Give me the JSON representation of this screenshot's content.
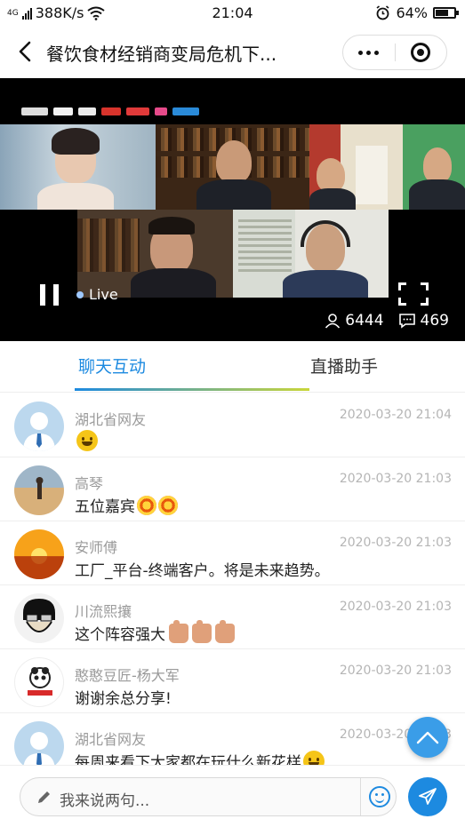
{
  "status_bar": {
    "signal": "4G",
    "speed": "388K/s",
    "time": "21:04",
    "battery": "64%"
  },
  "header": {
    "title": "餐饮食材经销商变局危机下..."
  },
  "video": {
    "live_label": "Live",
    "viewers": "6444",
    "comments": "469"
  },
  "tabs": [
    {
      "label": "聊天互动",
      "active": true
    },
    {
      "label": "直播助手",
      "active": false
    }
  ],
  "messages": [
    {
      "name": "湖北省网友",
      "time": "2020-03-20 21:04",
      "text": "",
      "emojis": [
        "grin"
      ]
    },
    {
      "name": "高琴",
      "time": "2020-03-20 21:03",
      "text": "五位嘉宾",
      "emojis": [
        "lollipop",
        "lollipop"
      ]
    },
    {
      "name": "安师傅",
      "time": "2020-03-20 21:03",
      "text": "工厂_平台-终端客户。将是未来趋势。",
      "emojis": []
    },
    {
      "name": "川流熙攘",
      "time": "2020-03-20 21:03",
      "text": "这个阵容强大",
      "emojis": [
        "thumbs-up",
        "thumbs-up",
        "thumbs-up"
      ]
    },
    {
      "name": "憨憨豆匠-杨大军",
      "time": "2020-03-20 21:03",
      "text": "谢谢余总分享!",
      "emojis": []
    },
    {
      "name": "湖北省网友",
      "time": "2020-03-20 21:03",
      "text": "每周来看下大家都在玩什么新花样",
      "emojis": [
        "grin"
      ]
    }
  ],
  "input": {
    "placeholder": "我来说两句..."
  },
  "colors": {
    "accent": "#1d8ae0",
    "tab_underline_end": "#c9d63a"
  }
}
